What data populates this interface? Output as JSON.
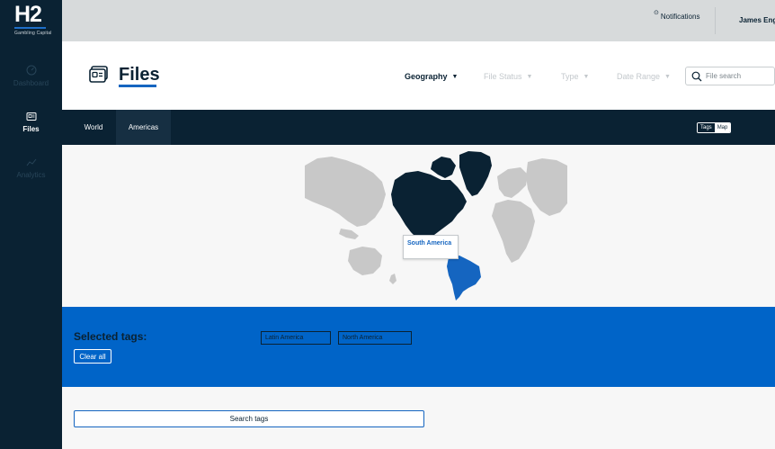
{
  "brand": {
    "logo_text": "H2",
    "logo_subtext": "Gambling Capital"
  },
  "sidebar": {
    "items": [
      {
        "label": "Dashboard",
        "icon": "dashboard-icon",
        "active": false
      },
      {
        "label": "Files",
        "icon": "files-icon",
        "active": true
      },
      {
        "label": "Analytics",
        "icon": "analytics-icon",
        "active": false
      }
    ]
  },
  "topbar": {
    "notifications_label": "Notifications",
    "user_name": "James Eng"
  },
  "header": {
    "title": "Files",
    "filters": [
      {
        "label": "Geography",
        "enabled": true
      },
      {
        "label": "File Status",
        "enabled": false
      },
      {
        "label": "Type",
        "enabled": false
      },
      {
        "label": "Date Range",
        "enabled": false
      }
    ],
    "search_placeholder": "File search"
  },
  "tabs": [
    {
      "label": "World",
      "active": false
    },
    {
      "label": "Americas",
      "active": true
    }
  ],
  "view_toggle": {
    "tags_label": "Tags",
    "map_label": "Map",
    "selected": "Map"
  },
  "map": {
    "tooltip": "South America",
    "highlighted": [
      {
        "region": "North America",
        "color": "#0a2233"
      },
      {
        "region": "South America",
        "color": "#1565c0"
      }
    ],
    "base_color": "#c8c8c8"
  },
  "selected_tags": {
    "title": "Selected tags:",
    "clear_label": "Clear all",
    "tags": [
      "Latin America",
      "North America"
    ]
  },
  "search_tags_label": "Search tags",
  "colors": {
    "navy": "#0a2233",
    "accent": "#0064c8",
    "link": "#1565c0"
  }
}
